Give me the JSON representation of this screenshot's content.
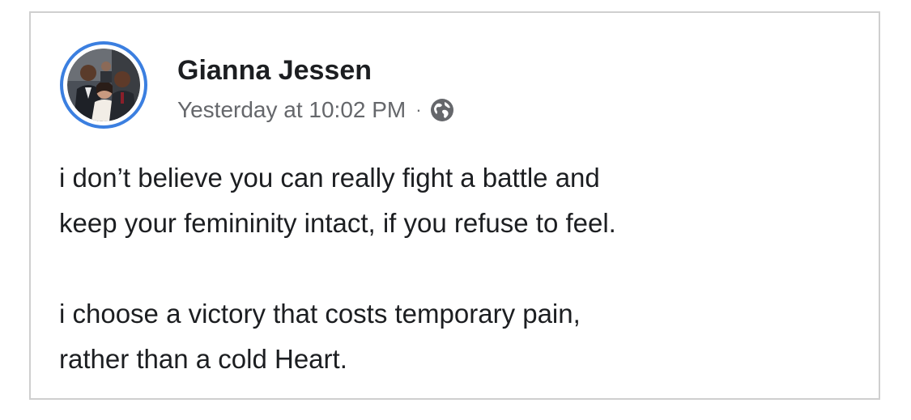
{
  "post": {
    "author": "Gianna Jessen",
    "timestamp": "Yesterday at 10:02 PM",
    "separator": "·",
    "privacy_icon": "globe-icon",
    "avatar_icon": "profile-photo",
    "paragraphs": [
      "i don’t believe you can really fight a battle and\nkeep your femininity intact, if you refuse to feel.",
      "i choose a victory that costs temporary pain,\nrather than a cold Heart."
    ]
  },
  "colors": {
    "avatar_ring": "#3b7fe0",
    "text_primary": "#1c1e21",
    "text_secondary": "#65676b",
    "card_border": "#cfcfcf"
  }
}
